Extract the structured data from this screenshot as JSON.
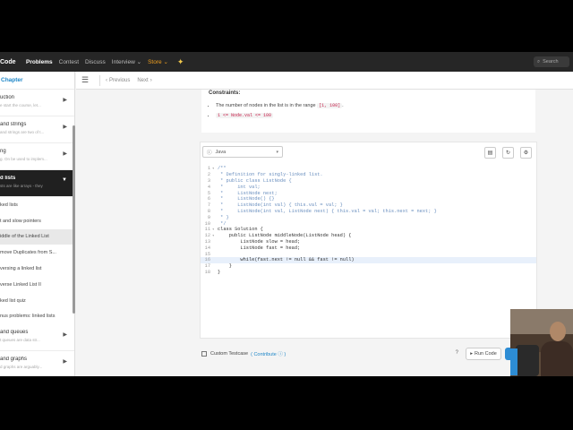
{
  "topnav": {
    "logo": "Code",
    "items": [
      "Problems",
      "Contest",
      "Discuss",
      "Interview",
      "Store"
    ],
    "search_placeholder": "Search"
  },
  "sidebar": {
    "chapter": "Chapter",
    "sections": [
      {
        "title": "uction",
        "desc": "e start the course, let..."
      },
      {
        "title": "and strings",
        "desc": "and strings are two of t..."
      },
      {
        "title": "ng",
        "desc": "g. On be used to implem..."
      },
      {
        "title": "d lists",
        "desc": "sts are like arrays - they"
      }
    ],
    "items": [
      "ked lists",
      "t and slow pointers",
      "iddle of the Linked List",
      "move Duplicates from S...",
      "versing a linked list",
      "verse Linked List II",
      "ked list quiz",
      "nus problems: linked lists"
    ],
    "sections_after": [
      {
        "title": "and queues",
        "desc": "t queues are data str..."
      },
      {
        "title": "and graphs",
        "desc": "d graphs are arguably..."
      }
    ]
  },
  "toolbar": {
    "previous": "Previous",
    "next": "Next"
  },
  "description": {
    "constraints_title": "Constraints:",
    "bullets": [
      {
        "before": "The number of nodes in the list is in the range ",
        "code": "[1, 100]",
        "after": "."
      },
      {
        "before": "",
        "code": "1 <= Node.val <= 100",
        "after": ""
      }
    ]
  },
  "editor": {
    "language": "Java",
    "lines": [
      {
        "n": "1",
        "text": "/**",
        "comment": true
      },
      {
        "n": "2",
        "text": " * Definition for singly-linked list.",
        "comment": true
      },
      {
        "n": "3",
        "text": " * public class ListNode {",
        "comment": true
      },
      {
        "n": "4",
        "text": " *     int val;",
        "comment": true
      },
      {
        "n": "5",
        "text": " *     ListNode next;",
        "comment": true
      },
      {
        "n": "6",
        "text": " *     ListNode() {}",
        "comment": true
      },
      {
        "n": "7",
        "text": " *     ListNode(int val) { this.val = val; }",
        "comment": true
      },
      {
        "n": "8",
        "text": " *     ListNode(int val, ListNode next) { this.val = val; this.next = next; }",
        "comment": true
      },
      {
        "n": "9",
        "text": " * }",
        "comment": true
      },
      {
        "n": "10",
        "text": " */",
        "comment": true
      },
      {
        "n": "11",
        "text": "class Solution {",
        "comment": false
      },
      {
        "n": "12",
        "text": "    public ListNode middleNode(ListNode head) {",
        "comment": false
      },
      {
        "n": "13",
        "text": "        ListNode slow = head;",
        "comment": false
      },
      {
        "n": "14",
        "text": "        ListNode fast = head;",
        "comment": false
      },
      {
        "n": "15",
        "text": "",
        "comment": false
      },
      {
        "n": "16",
        "text": "        while(fast.next != null && fast != null)",
        "comment": false
      },
      {
        "n": "17",
        "text": "    }",
        "comment": false
      },
      {
        "n": "18",
        "text": "}",
        "comment": false
      }
    ],
    "highlighted_line": "16"
  },
  "bottom": {
    "custom_testcase": "Custom Testcase",
    "contribute": "( Contribute ",
    "contribute_close": ")",
    "run_code": "Run Code"
  },
  "colors": {
    "accent": "#2d8cd4",
    "store": "#f0a020",
    "nav_bg": "#262626"
  }
}
